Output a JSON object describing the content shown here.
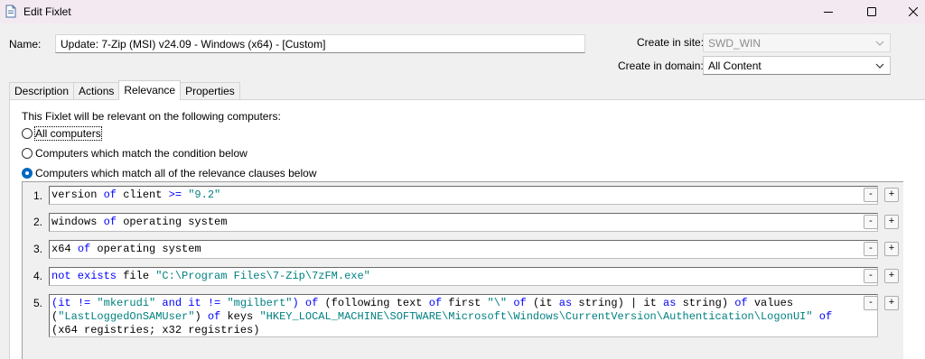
{
  "window": {
    "title": "Edit Fixlet",
    "controls": {
      "minimize": "minimize-icon",
      "maximize": "maximize-icon",
      "close": "close-icon"
    }
  },
  "form": {
    "name_label": "Name:",
    "name_value": "Update: 7-Zip (MSI) v24.09 - Windows (x64) - [Custom]",
    "site_label": "Create in site:",
    "site_value": "SWD_WIN",
    "domain_label": "Create in domain:",
    "domain_value": "All Content"
  },
  "tabs": [
    {
      "label": "Description",
      "active": false
    },
    {
      "label": "Actions",
      "active": false
    },
    {
      "label": "Relevance",
      "active": true
    },
    {
      "label": "Properties",
      "active": false
    }
  ],
  "relevance": {
    "intro": "This Fixlet will be relevant on the following computers:",
    "options": [
      {
        "label": "All computers",
        "checked": false
      },
      {
        "label": "Computers which match the condition below",
        "checked": false
      },
      {
        "label": "Computers which match all of the relevance clauses below",
        "checked": true
      }
    ],
    "clauses": [
      {
        "num": "1.",
        "tokens": [
          {
            "t": "version ",
            "c": ""
          },
          {
            "t": "of",
            "c": "kw"
          },
          {
            "t": " client ",
            "c": ""
          },
          {
            "t": ">=",
            "c": "kw"
          },
          {
            "t": " ",
            "c": ""
          },
          {
            "t": "\"9.2\"",
            "c": "str"
          }
        ]
      },
      {
        "num": "2.",
        "tokens": [
          {
            "t": "windows ",
            "c": ""
          },
          {
            "t": "of",
            "c": "kw"
          },
          {
            "t": " operating system",
            "c": ""
          }
        ]
      },
      {
        "num": "3.",
        "tokens": [
          {
            "t": "x64 ",
            "c": ""
          },
          {
            "t": "of",
            "c": "kw"
          },
          {
            "t": " operating system",
            "c": ""
          }
        ]
      },
      {
        "num": "4.",
        "tokens": [
          {
            "t": "not exists",
            "c": "kw"
          },
          {
            "t": " file ",
            "c": ""
          },
          {
            "t": "\"C:\\Program Files\\7-Zip\\7zFM.exe\"",
            "c": "str"
          }
        ]
      },
      {
        "num": "5.",
        "tokens": [
          {
            "t": "(it ",
            "c": "kw"
          },
          {
            "t": "!=",
            "c": "kw"
          },
          {
            "t": " ",
            "c": ""
          },
          {
            "t": "\"mkerudi\"",
            "c": "str"
          },
          {
            "t": " and it ",
            "c": "kw"
          },
          {
            "t": "!=",
            "c": "kw"
          },
          {
            "t": " ",
            "c": ""
          },
          {
            "t": "\"mgilbert\"",
            "c": "str"
          },
          {
            "t": ") ",
            "c": "kw"
          },
          {
            "t": "of",
            "c": "kw"
          },
          {
            "t": " (following text ",
            "c": ""
          },
          {
            "t": "of",
            "c": "kw"
          },
          {
            "t": " first ",
            "c": ""
          },
          {
            "t": "\"\\\"",
            "c": "str"
          },
          {
            "t": " ",
            "c": ""
          },
          {
            "t": "of",
            "c": "kw"
          },
          {
            "t": " (it ",
            "c": ""
          },
          {
            "t": "as",
            "c": "kw"
          },
          {
            "t": " string) | it ",
            "c": ""
          },
          {
            "t": "as",
            "c": "kw"
          },
          {
            "t": " string) ",
            "c": ""
          },
          {
            "t": "of",
            "c": "kw"
          },
          {
            "t": " values\n(",
            "c": ""
          },
          {
            "t": "\"LastLoggedOnSAMUser\"",
            "c": "str"
          },
          {
            "t": ") ",
            "c": ""
          },
          {
            "t": "of",
            "c": "kw"
          },
          {
            "t": " keys ",
            "c": ""
          },
          {
            "t": "\"HKEY_LOCAL_MACHINE\\SOFTWARE\\Microsoft\\Windows\\CurrentVersion\\Authentication\\LogonUI\"",
            "c": "str"
          },
          {
            "t": " ",
            "c": ""
          },
          {
            "t": "of",
            "c": "kw"
          },
          {
            "t": "\n(x64 registries; x32 registries)",
            "c": ""
          }
        ]
      }
    ],
    "remove_label": "-",
    "add_label": "+"
  }
}
